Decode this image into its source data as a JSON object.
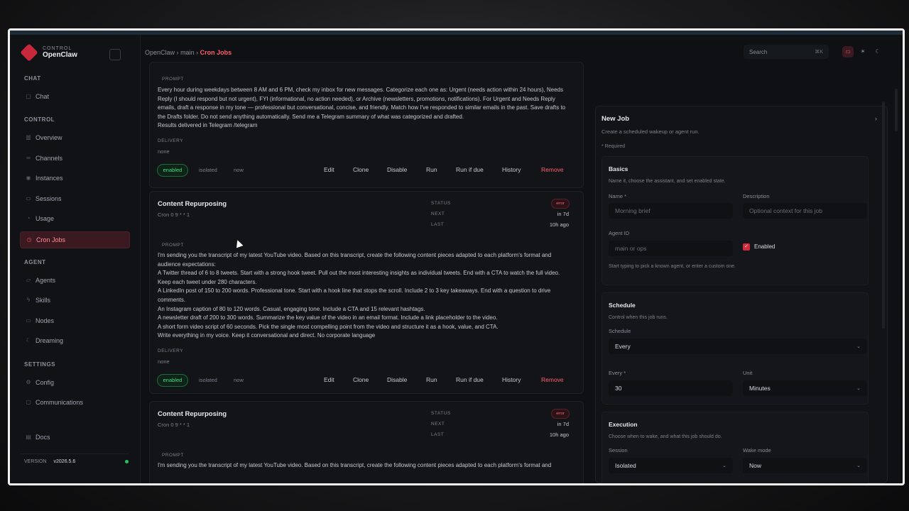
{
  "brand": {
    "small": "CONTROL",
    "name": "OpenClaw"
  },
  "sidebar": {
    "sections": {
      "chat": "CHAT",
      "control": "CONTROL",
      "agent": "AGENT",
      "settings": "SETTINGS"
    },
    "items": [
      {
        "label": "Chat",
        "icon": "chat-bubble-icon"
      },
      {
        "label": "Overview",
        "icon": "bar-chart-icon"
      },
      {
        "label": "Channels",
        "icon": "link-icon"
      },
      {
        "label": "Instances",
        "icon": "radio-icon"
      },
      {
        "label": "Sessions",
        "icon": "file-icon"
      },
      {
        "label": "Usage",
        "icon": "gauge-icon"
      },
      {
        "label": "Cron Jobs",
        "icon": "clock-icon"
      },
      {
        "label": "Agents",
        "icon": "folder-icon"
      },
      {
        "label": "Skills",
        "icon": "zap-icon"
      },
      {
        "label": "Nodes",
        "icon": "monitor-icon"
      },
      {
        "label": "Dreaming",
        "icon": "moon-icon"
      },
      {
        "label": "Config",
        "icon": "gear-icon"
      },
      {
        "label": "Communications",
        "icon": "message-icon"
      },
      {
        "label": "Docs",
        "icon": "book-icon"
      }
    ],
    "version_label": "VERSION",
    "version_value": "v2026.5.6"
  },
  "header": {
    "crumbs": [
      "OpenClaw",
      "main",
      "Cron Jobs"
    ],
    "sep": "›",
    "search_placeholder": "Search",
    "search_shortcut": "⌘K"
  },
  "jobs": {
    "labels": {
      "prompt": "PROMPT",
      "delivery": "DELIVERY",
      "status": "STATUS",
      "next": "NEXT",
      "last": "LAST"
    },
    "first": {
      "prompt": "Every hour during weekdays between 8 AM and 6 PM, check my inbox for new messages. Categorize each one as: Urgent (needs action within 24 hours), Needs Reply (I should respond but not urgent), FYI (informational, no action needed), or Archive (newsletters, promotions, notifications). For Urgent and Needs Reply emails, draft a response in my tone — professional but conversational, concise, and friendly. Match how I've responded to similar emails in the past. Save drafts to the Drafts folder. Do not send anything automatically. Send me a Telegram summary of what was categorized and drafted.\nResults delivered in Telegram /telegram",
      "delivery": "none",
      "enabled": "enabled",
      "mode": "isolated",
      "wake": "now"
    },
    "second": {
      "name": "Content Repurposing",
      "cron": "Cron 0 9 * * 1",
      "status": "error",
      "next": "in 7d",
      "last": "10h ago",
      "prompt": "I'm sending you the transcript of my latest YouTube video. Based on this transcript, create the following content pieces adapted to each platform's format and audience expectations:\nA Twitter thread of 6 to 8 tweets. Start with a strong hook tweet. Pull out the most interesting insights as individual tweets. End with a CTA to watch the full video. Keep each tweet under 280 characters.\nA LinkedIn post of 150 to 200 words. Professional tone. Start with a hook line that stops the scroll. Include 2 to 3 key takeaways. End with a question to drive comments.\nAn Instagram caption of 80 to 120 words. Casual, engaging tone. Include a CTA and 15 relevant hashtags.\nA newsletter draft of 200 to 300 words. Summarize the key value of the video in an email format. Include a link placeholder to the video.\nA short form video script of 60 seconds. Pick the single most compelling point from the video and structure it as a hook, value, and CTA.\nWrite everything in my voice. Keep it conversational and direct. No corporate language",
      "delivery": "none",
      "enabled": "enabled",
      "mode": "isolated",
      "wake": "now"
    },
    "third": {
      "name": "Content Repurposing",
      "cron": "Cron 0 9 * * 1",
      "status": "error",
      "next": "in 7d",
      "last": "10h ago",
      "prompt": "I'm sending you the transcript of my latest YouTube video. Based on this transcript, create the following content pieces adapted to each platform's format and"
    },
    "actions": {
      "edit": "Edit",
      "clone": "Clone",
      "disable": "Disable",
      "run": "Run",
      "run_if_due": "Run if due",
      "history": "History",
      "remove": "Remove"
    }
  },
  "panel": {
    "title": "New Job",
    "subtitle": "Create a scheduled wakeup or agent run.",
    "required": "* Required",
    "basics": {
      "title": "Basics",
      "sub": "Name it, choose the assistant, and set enabled state.",
      "name_label": "Name *",
      "name_placeholder": "Morning brief",
      "desc_label": "Description",
      "desc_placeholder": "Optional context for this job",
      "agent_label": "Agent ID",
      "agent_placeholder": "main or ops",
      "enabled_label": "Enabled",
      "hint": "Start typing to pick a known agent, or enter a custom one."
    },
    "schedule": {
      "title": "Schedule",
      "sub": "Control when this job runs.",
      "schedule_label": "Schedule",
      "schedule_value": "Every",
      "every_label": "Every *",
      "every_value": "30",
      "unit_label": "Unit",
      "unit_value": "Minutes"
    },
    "execution": {
      "title": "Execution",
      "sub": "Choose when to wake, and what this job should do.",
      "session_label": "Session",
      "session_value": "Isolated",
      "wake_label": "Wake mode",
      "wake_value": "Now"
    }
  }
}
